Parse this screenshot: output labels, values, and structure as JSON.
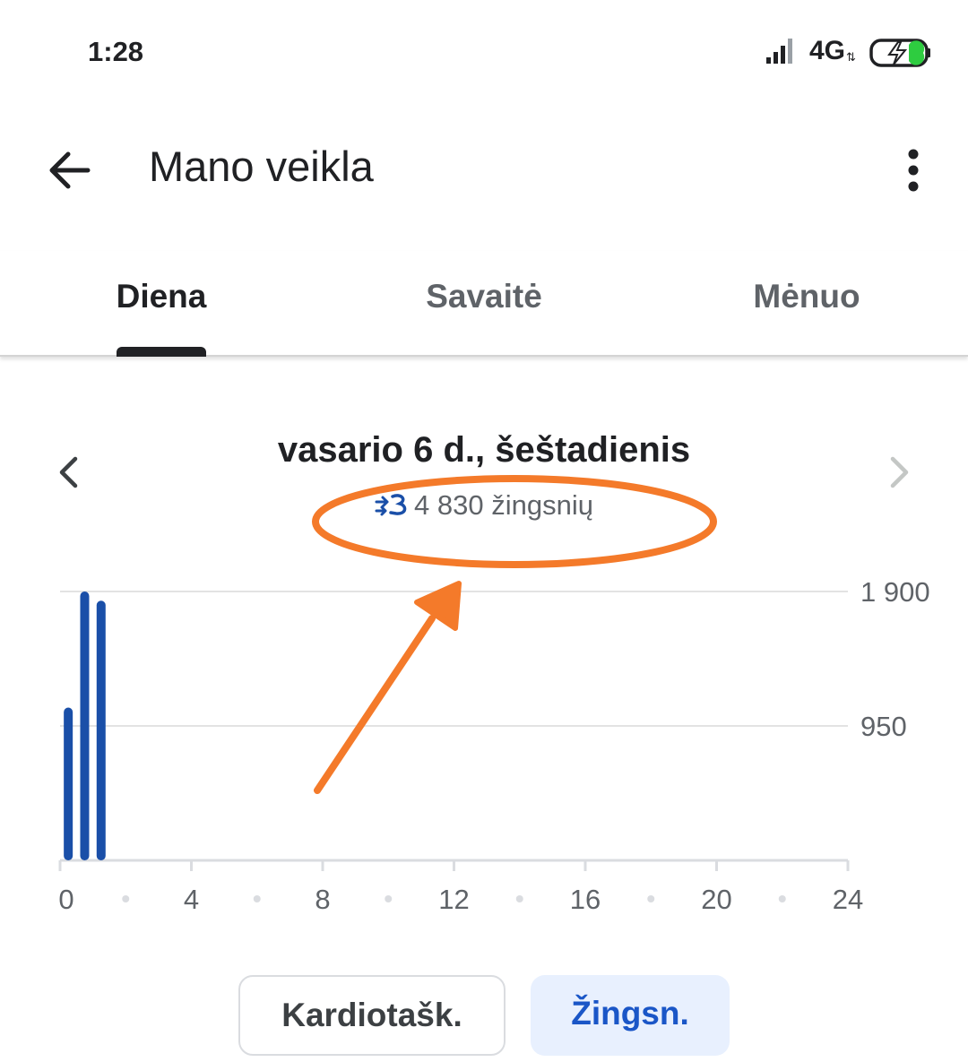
{
  "status_bar": {
    "time": "1:28",
    "network": "4G",
    "icons": [
      "signal-icon",
      "network-arrows-icon",
      "battery-charging-icon"
    ]
  },
  "app_bar": {
    "title": "Mano veikla",
    "back_icon": "arrow-back-icon",
    "more_icon": "more-vert-icon"
  },
  "tabs": [
    {
      "label": "Diena",
      "active": true
    },
    {
      "label": "Savaitė",
      "active": false
    },
    {
      "label": "Mėnuo",
      "active": false
    }
  ],
  "date_nav": {
    "date": "vasario 6 d., šeštadienis",
    "steps_text": "4 830 žingsnių",
    "steps_icon": "steps-icon"
  },
  "chart_data": {
    "type": "bar",
    "x_ticks": [
      "0",
      "4",
      "8",
      "12",
      "16",
      "20",
      "24"
    ],
    "y_ticks": [
      "1 900",
      "950"
    ],
    "xlim": [
      0,
      24
    ],
    "ylim": [
      0,
      1900
    ],
    "bars": [
      {
        "x": 0.25,
        "value": 1080
      },
      {
        "x": 0.75,
        "value": 1900
      },
      {
        "x": 1.25,
        "value": 1835
      }
    ],
    "bar_color": "#1a4fa8",
    "grid": true
  },
  "annotation": {
    "color": "#f47a2a",
    "shapes": [
      "ellipse-highlight",
      "arrow"
    ]
  },
  "metric_buttons": {
    "cardio_label": "Kardiotašk.",
    "steps_label": "Žingsn."
  },
  "colors": {
    "accent_blue": "#1a56c7",
    "selected_bg": "#e8f0fe",
    "text_primary": "#202124",
    "text_secondary": "#5f6368"
  }
}
